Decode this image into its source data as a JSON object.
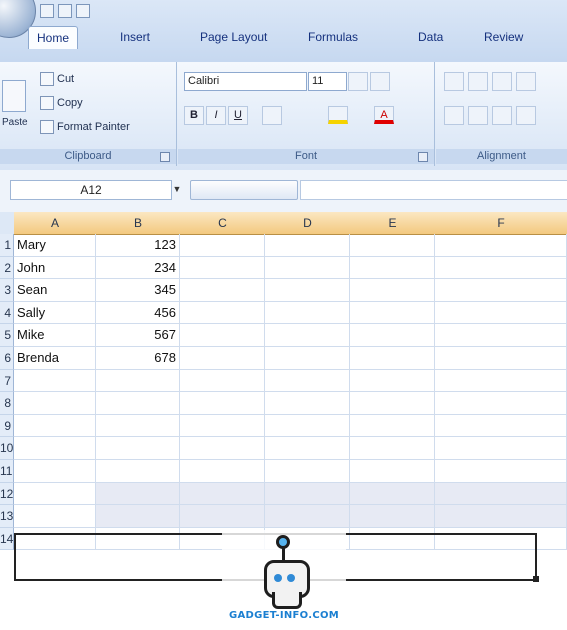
{
  "tabs": [
    "Home",
    "Insert",
    "Page Layout",
    "Formulas",
    "Data",
    "Review"
  ],
  "active_tab": "Home",
  "ribbon": {
    "clipboard": {
      "label": "Clipboard",
      "paste": "Paste",
      "cut": "Cut",
      "copy": "Copy",
      "format_painter": "Format Painter"
    },
    "font": {
      "label": "Font",
      "name": "Calibri",
      "size": "11",
      "bold": "B",
      "italic": "I",
      "underline": "U",
      "font_color": "A"
    },
    "alignment": {
      "label": "Alignment"
    }
  },
  "formula_bar": {
    "name_box": "A12",
    "formula": ""
  },
  "columns": [
    "A",
    "B",
    "C",
    "D",
    "E",
    "F"
  ],
  "rows": [
    {
      "num": "1",
      "a": "Mary",
      "b": "123"
    },
    {
      "num": "2",
      "a": "John",
      "b": "234"
    },
    {
      "num": "3",
      "a": "Sean",
      "b": "345"
    },
    {
      "num": "4",
      "a": "Sally",
      "b": "456"
    },
    {
      "num": "5",
      "a": "Mike",
      "b": "567"
    },
    {
      "num": "6",
      "a": "Brenda",
      "b": "678"
    },
    {
      "num": "7",
      "a": "",
      "b": ""
    },
    {
      "num": "8",
      "a": "",
      "b": ""
    },
    {
      "num": "9",
      "a": "",
      "b": ""
    },
    {
      "num": "10",
      "a": "",
      "b": ""
    },
    {
      "num": "11",
      "a": "",
      "b": ""
    },
    {
      "num": "12",
      "a": "",
      "b": ""
    },
    {
      "num": "13",
      "a": "",
      "b": ""
    },
    {
      "num": "14",
      "a": "",
      "b": ""
    }
  ],
  "watermark": {
    "text": "GADGET-INFO.COM"
  },
  "colors": {
    "accent": "#15317e",
    "header_highlight": "#f3c97f",
    "selection": "#e7eaf4"
  }
}
